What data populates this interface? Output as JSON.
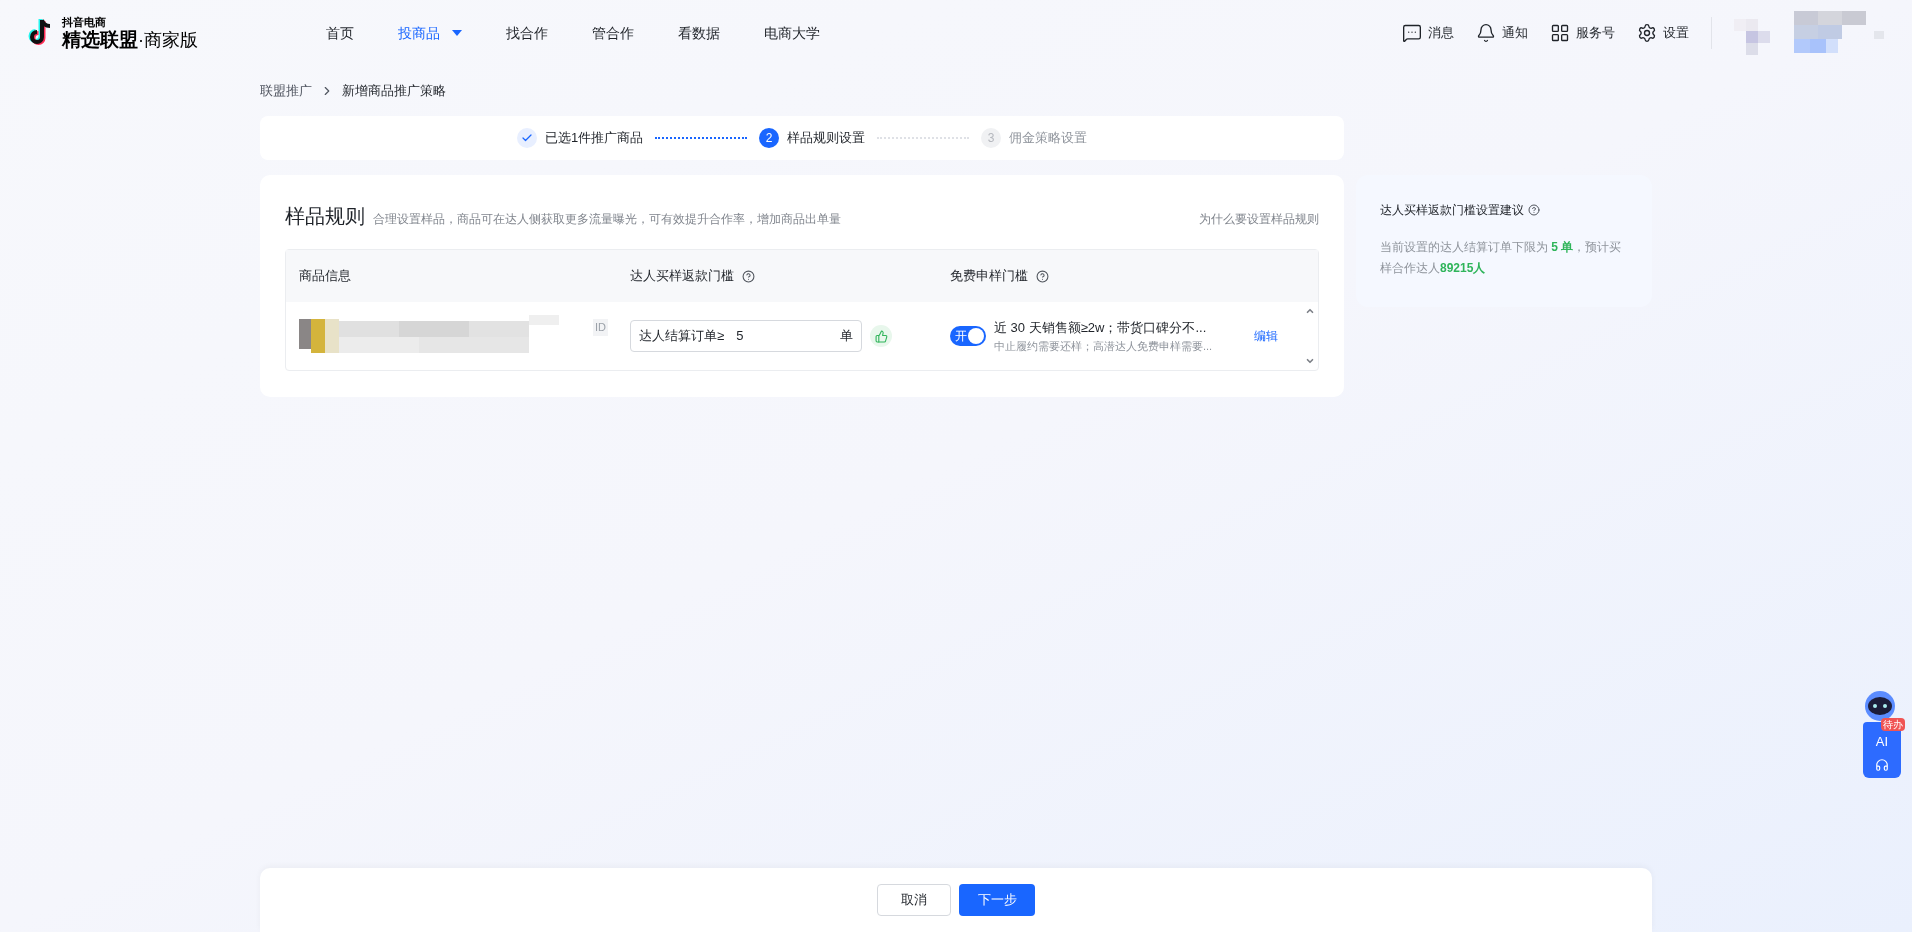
{
  "logo": {
    "small": "抖音电商",
    "main": "精选联盟",
    "suffix": "·商家版"
  },
  "nav": [
    {
      "label": "首页",
      "selected": false,
      "dropdown": false
    },
    {
      "label": "投商品",
      "selected": true,
      "dropdown": true
    },
    {
      "label": "找合作",
      "selected": false,
      "dropdown": false
    },
    {
      "label": "管合作",
      "selected": false,
      "dropdown": false
    },
    {
      "label": "看数据",
      "selected": false,
      "dropdown": false
    },
    {
      "label": "电商大学",
      "selected": false,
      "dropdown": false
    }
  ],
  "header_actions": [
    {
      "kind": "message",
      "label": "消息"
    },
    {
      "kind": "bell",
      "label": "通知"
    },
    {
      "kind": "grid",
      "label": "服务号"
    },
    {
      "kind": "gear",
      "label": "设置"
    }
  ],
  "breadcrumb": [
    "联盟推广",
    "新增商品推广策略"
  ],
  "steps": [
    {
      "label": "已选1件推广商品",
      "done": true,
      "selected": false
    },
    {
      "label": "样品规则设置",
      "number": "2",
      "done": false,
      "selected": true
    },
    {
      "label": "佣金策略设置",
      "number": "3",
      "done": false,
      "selected": false
    }
  ],
  "section": {
    "title": "样品规则",
    "subtitle": "合理设置样品，商品可在达人侧获取更多流量曝光，可有效提升合作率，增加商品出单量",
    "help_link": "为什么要设置样品规则"
  },
  "table": {
    "columns": [
      {
        "label": "商品信息",
        "help": false
      },
      {
        "label": "达人买样返款门槛",
        "help": true
      },
      {
        "label": "免费申样门槛",
        "help": true
      }
    ],
    "rows": [
      {
        "product": {
          "kind": "picture",
          "id_label": "ID"
        },
        "threshold": {
          "prefix": "达人结算订单≥",
          "value": "5",
          "suffix": "单",
          "liked": true
        },
        "free_sample": {
          "on": true,
          "switch_label": "开",
          "line1": "近 30 天销售额≥2w；带货口碑分不...",
          "line2": "中止履约需要还样；高潜达人免费申样需要...",
          "action": "编辑"
        }
      }
    ]
  },
  "advice": {
    "title": "达人买样返款门槛设置建议",
    "text": "当前设置的达人结算订单下限为 **5 单**，预计买样合作达人**89215人**"
  },
  "assistant": {
    "badge": "待办",
    "label": "AI"
  },
  "footer_buttons": [
    {
      "label": "取消",
      "primary": false
    },
    {
      "label": "下一步",
      "primary": true
    }
  ]
}
